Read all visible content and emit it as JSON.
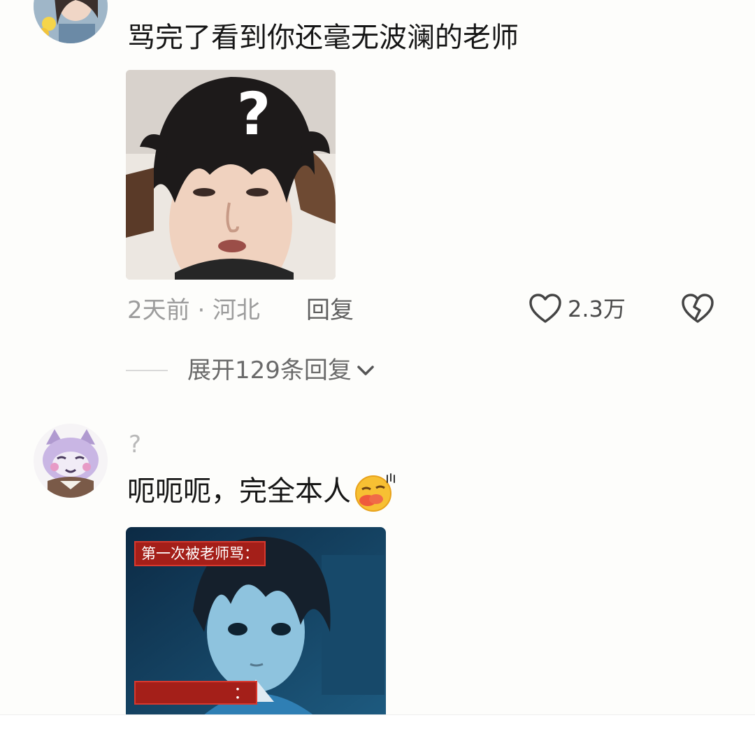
{
  "comment1": {
    "text": "骂完了看到你还毫无波澜的老师",
    "meta": "2天前 · 河北",
    "reply_label": "回复",
    "like_count": "2.3万",
    "expand_label": "展开129条回复"
  },
  "comment2": {
    "username": "?",
    "text": "呃呃呃，完全本人",
    "image_caption_top": "第一次被老师骂：",
    "image_caption_bottom_suffix": "："
  },
  "icons": {
    "like": "heart-outline-icon",
    "dislike": "broken-heart-icon",
    "expand": "chevron-down-icon",
    "emoji": "duck-lips-emoji-icon"
  },
  "colors": {
    "background": "#fdfdfb",
    "caption_red": "#a41f19",
    "meta_gray": "#9c9c9c"
  }
}
